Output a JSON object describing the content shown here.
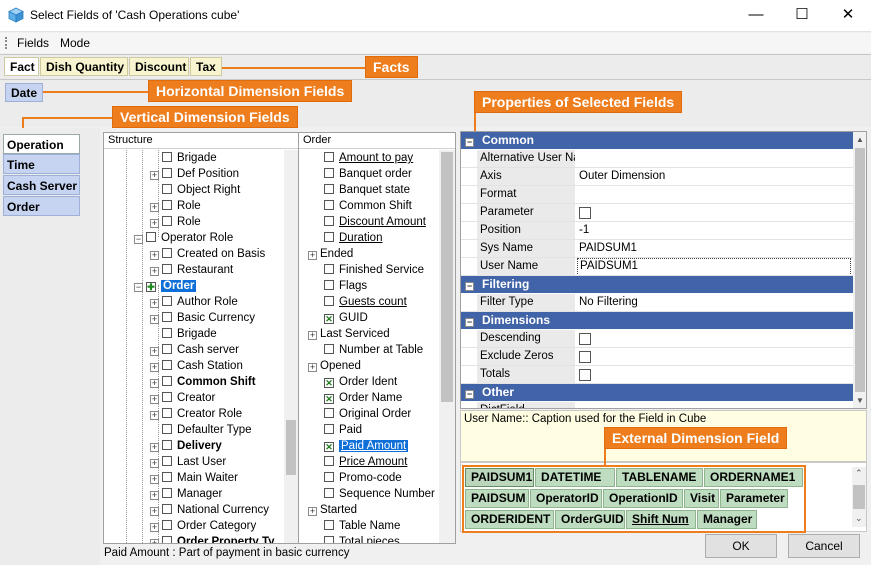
{
  "window": {
    "title": "Select Fields of 'Cash Operations cube'",
    "minimize_glyph": "—",
    "maximize_glyph": "☐",
    "close_glyph": "✕"
  },
  "menu": [
    "Fields",
    "Mode"
  ],
  "fact_tabs": [
    "Fact",
    "Dish Quantity",
    "Discount",
    "Tax"
  ],
  "horizontal_fields": [
    "Date"
  ],
  "vertical_fields": [
    "Operation",
    "Time",
    "Cash Server",
    "Order"
  ],
  "callouts": {
    "facts": "Facts",
    "horizontal": "Horizontal Dimension Fields",
    "vertical": "Vertical Dimension Fields",
    "properties": "Properties of Selected Fields",
    "external": "External Dimension Field"
  },
  "structure": {
    "header": "Structure",
    "rows": [
      {
        "label": "Brigade",
        "level": 3,
        "expander": "",
        "bold": false
      },
      {
        "label": "Def Position",
        "level": 3,
        "expander": "+",
        "bold": false
      },
      {
        "label": "Object Right",
        "level": 3,
        "expander": "",
        "bold": false
      },
      {
        "label": "Role",
        "level": 3,
        "expander": "+",
        "bold": false
      },
      {
        "label": "Role",
        "level": 3,
        "expander": "+",
        "bold": false
      },
      {
        "label": "Operator Role",
        "level": 2,
        "expander": "−",
        "bold": false
      },
      {
        "label": "Created on Basis",
        "level": 3,
        "expander": "+",
        "bold": false
      },
      {
        "label": "Restaurant",
        "level": 3,
        "expander": "+",
        "bold": false
      },
      {
        "label": "Order",
        "level": 2,
        "expander": "−",
        "bold": true,
        "selected": true
      },
      {
        "label": "Author Role",
        "level": 3,
        "expander": "+",
        "bold": false
      },
      {
        "label": "Basic Currency",
        "level": 3,
        "expander": "+",
        "bold": false
      },
      {
        "label": "Brigade",
        "level": 3,
        "expander": "",
        "bold": false
      },
      {
        "label": "Cash server",
        "level": 3,
        "expander": "+",
        "bold": false
      },
      {
        "label": "Cash Station",
        "level": 3,
        "expander": "+",
        "bold": false
      },
      {
        "label": "Common Shift",
        "level": 3,
        "expander": "+",
        "bold": true
      },
      {
        "label": "Creator",
        "level": 3,
        "expander": "+",
        "bold": false
      },
      {
        "label": "Creator Role",
        "level": 3,
        "expander": "+",
        "bold": false
      },
      {
        "label": "Defaulter Type",
        "level": 3,
        "expander": "",
        "bold": false
      },
      {
        "label": "Delivery",
        "level": 3,
        "expander": "+",
        "bold": true
      },
      {
        "label": "Last User",
        "level": 3,
        "expander": "+",
        "bold": false
      },
      {
        "label": "Main Waiter",
        "level": 3,
        "expander": "+",
        "bold": false
      },
      {
        "label": "Manager",
        "level": 3,
        "expander": "+",
        "bold": false
      },
      {
        "label": "National Currency",
        "level": 3,
        "expander": "+",
        "bold": false
      },
      {
        "label": "Order Category",
        "level": 3,
        "expander": "+",
        "bold": false
      },
      {
        "label": "Order Property Ty",
        "level": 3,
        "expander": "+",
        "bold": true
      }
    ]
  },
  "order": {
    "header": "Order",
    "rows": [
      {
        "label": "Amount to pay",
        "indent": 1,
        "checked": false,
        "underline": true
      },
      {
        "label": "Banquet order",
        "indent": 1,
        "checked": false
      },
      {
        "label": "Banquet state",
        "indent": 1,
        "checked": false
      },
      {
        "label": "Common Shift",
        "indent": 1,
        "checked": false
      },
      {
        "label": "Discount Amount",
        "indent": 1,
        "checked": false,
        "underline": true
      },
      {
        "label": "Duration",
        "indent": 1,
        "checked": false,
        "underline": true
      },
      {
        "label": "Ended",
        "indent": 0,
        "expander": "+"
      },
      {
        "label": "Finished Service",
        "indent": 1,
        "checked": false
      },
      {
        "label": "Flags",
        "indent": 1,
        "checked": false
      },
      {
        "label": "Guests count",
        "indent": 1,
        "checked": false,
        "underline": true
      },
      {
        "label": "GUID",
        "indent": 1,
        "checked": true
      },
      {
        "label": "Last Serviced",
        "indent": 0,
        "expander": "+"
      },
      {
        "label": "Number at Table",
        "indent": 1,
        "checked": false
      },
      {
        "label": "Opened",
        "indent": 0,
        "expander": "+"
      },
      {
        "label": "Order Ident",
        "indent": 1,
        "checked": true
      },
      {
        "label": "Order Name",
        "indent": 1,
        "checked": true
      },
      {
        "label": "Original Order",
        "indent": 1,
        "checked": false
      },
      {
        "label": "Paid",
        "indent": 1,
        "checked": false
      },
      {
        "label": "Paid Amount",
        "indent": 1,
        "checked": true,
        "underline": true,
        "selected": true
      },
      {
        "label": "Price Amount",
        "indent": 1,
        "checked": false,
        "underline": true
      },
      {
        "label": "Promo-code",
        "indent": 1,
        "checked": false
      },
      {
        "label": "Sequence Number",
        "indent": 1,
        "checked": false
      },
      {
        "label": "Started",
        "indent": 0,
        "expander": "+"
      },
      {
        "label": "Table Name",
        "indent": 1,
        "checked": false
      },
      {
        "label": "Total pieces",
        "indent": 1,
        "checked": false
      }
    ]
  },
  "status": "Paid Amount : Part of payment in basic currency",
  "properties": {
    "sections": [
      {
        "name": "Common",
        "rows": [
          {
            "name": "Alternative User Na",
            "value": ""
          },
          {
            "name": "Axis",
            "value": "Outer Dimension"
          },
          {
            "name": "Format",
            "value": ""
          },
          {
            "name": "Parameter",
            "value": "",
            "checkbox": true
          },
          {
            "name": "Position",
            "value": "-1"
          },
          {
            "name": "Sys Name",
            "value": "PAIDSUM1"
          },
          {
            "name": "User Name",
            "value": "PAIDSUM1",
            "editing": true
          }
        ]
      },
      {
        "name": "Filtering",
        "rows": [
          {
            "name": "Filter Type",
            "value": "No Filtering"
          }
        ]
      },
      {
        "name": "Dimensions",
        "rows": [
          {
            "name": "Descending",
            "value": "",
            "checkbox": true
          },
          {
            "name": "Exclude Zeros",
            "value": "",
            "checkbox": true
          },
          {
            "name": "Totals",
            "value": "",
            "checkbox": true
          }
        ]
      },
      {
        "name": "Other",
        "rows": [
          {
            "name": "DictField",
            "value": ""
          }
        ]
      }
    ],
    "description": "User Name:: Caption used for the Field in Cube"
  },
  "external_fields": [
    [
      "PAIDSUM1",
      "DATETIME",
      "TABLENAME",
      "ORDERNAME1"
    ],
    [
      "PAIDSUM",
      "OperatorID",
      "OperationID",
      "Visit",
      "Parameter"
    ],
    [
      "ORDERIDENT",
      "OrderGUID",
      "Shift Num",
      "Manager"
    ]
  ],
  "buttons": {
    "ok": "OK",
    "cancel": "Cancel"
  }
}
